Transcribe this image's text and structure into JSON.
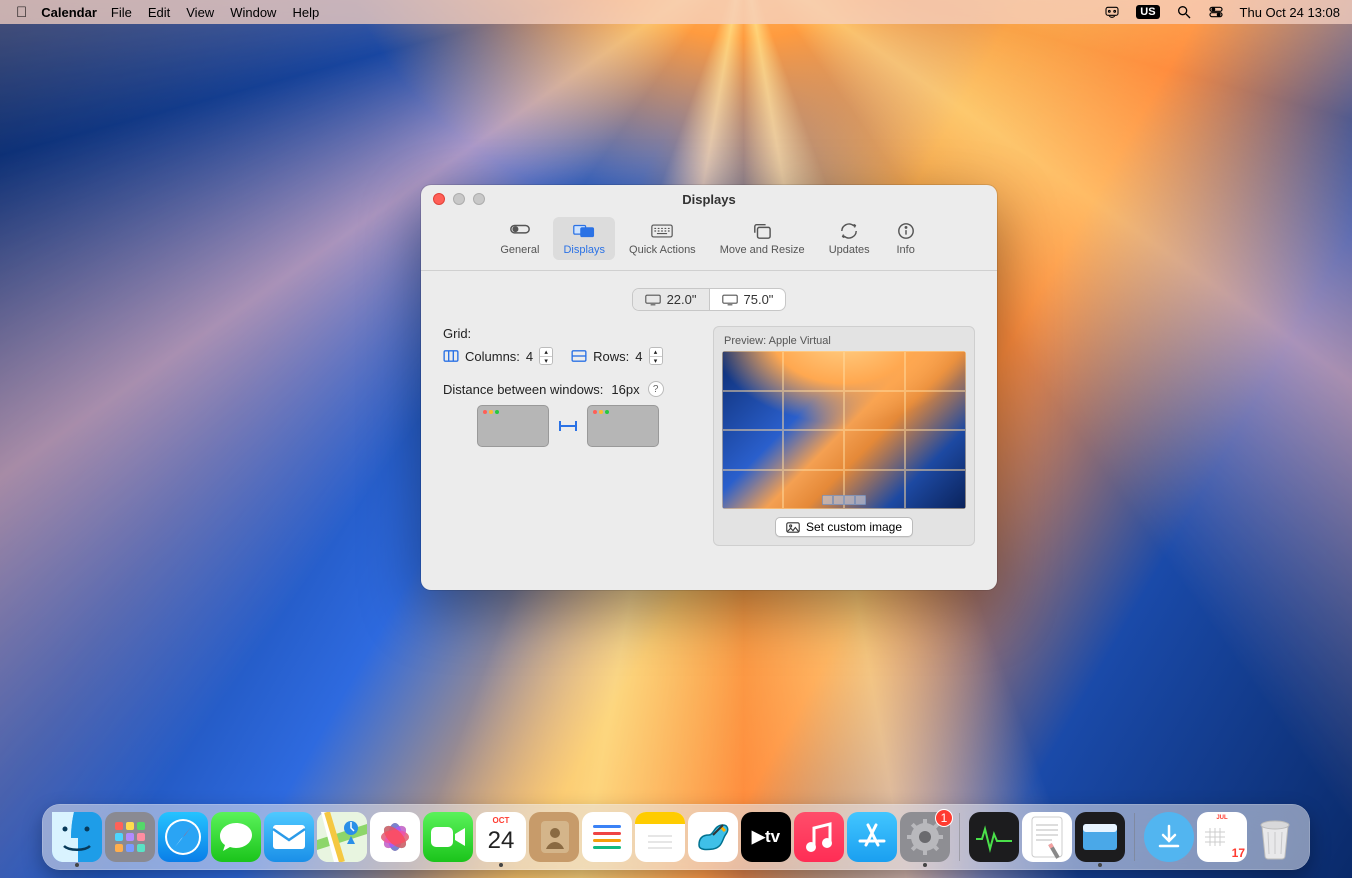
{
  "menubar": {
    "app_name": "Calendar",
    "items": [
      "File",
      "Edit",
      "View",
      "Window",
      "Help"
    ],
    "input_badge": "US",
    "datetime": "Thu Oct 24  13:08"
  },
  "window": {
    "title": "Displays",
    "tabs": [
      {
        "label": "General"
      },
      {
        "label": "Displays"
      },
      {
        "label": "Quick Actions"
      },
      {
        "label": "Move and Resize"
      },
      {
        "label": "Updates"
      },
      {
        "label": "Info"
      }
    ],
    "active_tab": "Displays",
    "display_segments": [
      {
        "label": "22.0\"",
        "selected": true
      },
      {
        "label": "75.0\"",
        "selected": false
      }
    ],
    "grid_label": "Grid:",
    "columns_label": "Columns:",
    "columns_value": "4",
    "rows_label": "Rows:",
    "rows_value": "4",
    "distance_label": "Distance between windows:",
    "distance_value": "16px",
    "preview_label": "Preview: Apple Virtual",
    "set_image_label": "Set custom image"
  },
  "dock": {
    "icons_left": [
      {
        "name": "finder",
        "running": true
      },
      {
        "name": "launchpad",
        "running": false
      },
      {
        "name": "safari",
        "running": false
      },
      {
        "name": "messages",
        "running": false
      },
      {
        "name": "mail",
        "running": false
      },
      {
        "name": "maps",
        "running": false
      },
      {
        "name": "photos",
        "running": false
      },
      {
        "name": "facetime",
        "running": false
      },
      {
        "name": "calendar",
        "running": true,
        "month": "Oct",
        "day": "24"
      },
      {
        "name": "contacts",
        "running": false
      },
      {
        "name": "reminders",
        "running": false
      },
      {
        "name": "notes",
        "running": false
      },
      {
        "name": "freeform",
        "running": false
      },
      {
        "name": "tv",
        "running": false
      },
      {
        "name": "music",
        "running": false
      },
      {
        "name": "appstore",
        "running": false
      },
      {
        "name": "system-settings",
        "running": true,
        "badge": "1"
      }
    ],
    "icons_right": [
      {
        "name": "activity-monitor"
      },
      {
        "name": "textedit"
      },
      {
        "name": "rectangle",
        "running": true
      }
    ],
    "icons_end": [
      {
        "name": "downloads"
      },
      {
        "name": "calendar-doc",
        "month": "Jul",
        "day": "17"
      },
      {
        "name": "trash"
      }
    ],
    "calendar_month": "Oct",
    "calendar_day": "24",
    "settings_badge": "1",
    "caldoc_month": "Jul",
    "caldoc_day": "17",
    "tv_label": "▶tv"
  }
}
